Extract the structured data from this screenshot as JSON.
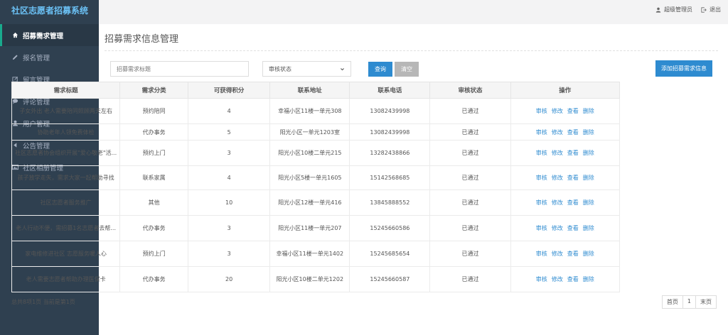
{
  "app": {
    "brand": "社区志愿者招募系统"
  },
  "sidebar": {
    "items": [
      {
        "label": "招募需求管理",
        "icon": "home-icon"
      },
      {
        "label": "报名管理",
        "icon": "pencil-icon"
      },
      {
        "label": "留言管理",
        "icon": "edit-icon"
      },
      {
        "label": "评论管理",
        "icon": "comment-icon"
      },
      {
        "label": "用户管理",
        "icon": "user-icon"
      },
      {
        "label": "公告管理",
        "icon": "caret-left-icon"
      },
      {
        "label": "社区相册管理",
        "icon": "image-icon"
      }
    ]
  },
  "topbar": {
    "user": "超级管理员",
    "logout": "退出"
  },
  "page": {
    "title": "招募需求信息管理"
  },
  "search": {
    "placeholder": "招募需求标题",
    "status_value": "审核状态"
  },
  "buttons": {
    "query": "查询",
    "clear": "清空",
    "add": "添加招募需求信息"
  },
  "table": {
    "headers": [
      "需求标题",
      "需求分类",
      "可获得积分",
      "联系地址",
      "联系电话",
      "审核状态",
      "操作"
    ],
    "actions": [
      "审核",
      "修改",
      "查看",
      "删除"
    ],
    "rows": [
      [
        "子女外出 老人需要陪同照顾两天左右",
        "预约陪同",
        "4",
        "幸福小区11楼一单元308",
        "13082439998",
        "已通过"
      ],
      [
        "协助老年人领免费体检",
        "代办事务",
        "5",
        "阳光小区一单元1203室",
        "13082439998",
        "已通过"
      ],
      [
        "社区志愿者协会组织开展\"爱心敬老\"活...",
        "预约上门",
        "3",
        "阳光小区10楼二单元215",
        "13282438866",
        "已通过"
      ],
      [
        "孩子放学走失，需求大家一起帮助寻找",
        "联系家属",
        "4",
        "阳光小区5楼一单元1605",
        "15142568685",
        "已通过"
      ],
      [
        "社区志愿者服务推广",
        "其他",
        "10",
        "阳光小区12楼一单元416",
        "13845888552",
        "已通过"
      ],
      [
        "老人行动不便，需招募1名志愿者去帮...",
        "代办事务",
        "3",
        "阳光小区11楼一单元207",
        "15245660586",
        "已通过"
      ],
      [
        "家电维修进社区 志愿服务暖人心",
        "预约上门",
        "3",
        "幸福小区11楼一单元1402",
        "15245685654",
        "已通过"
      ],
      [
        "老人需要志愿者帮助办理医保卡",
        "代办事务",
        "20",
        "阳光小区10楼二单元1202",
        "15245660587",
        "已通过"
      ]
    ]
  },
  "footer": {
    "summary": "总共8项1页   当前是第1页",
    "pager": [
      "首页",
      "1",
      "末页"
    ]
  }
}
